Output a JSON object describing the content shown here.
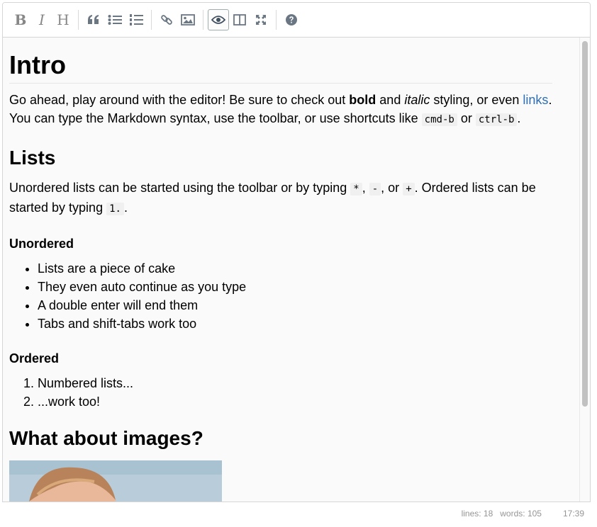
{
  "toolbar": {
    "buttons": [
      {
        "name": "bold-button",
        "glyph": "B"
      },
      {
        "name": "italic-button",
        "glyph": "I"
      },
      {
        "name": "heading-button",
        "glyph": "H"
      }
    ]
  },
  "content": {
    "intro_heading": "Intro",
    "intro_p1_a": "Go ahead, play around with the editor! Be sure to check out ",
    "intro_bold": "bold",
    "intro_p1_b": " and ",
    "intro_italic": "italic",
    "intro_p1_c": " styling, or even ",
    "intro_link": "links",
    "intro_p1_d": ". You can type the Markdown syntax, use the toolbar, or use shortcuts like ",
    "intro_code1": "cmd-b",
    "intro_p1_e": " or ",
    "intro_code2": "ctrl-b",
    "intro_p1_f": ".",
    "lists_heading": "Lists",
    "lists_p_a": "Unordered lists can be started using the toolbar or by typing ",
    "lists_code_star": "*",
    "lists_p_b": ", ",
    "lists_code_dash": "-",
    "lists_p_c": ", or ",
    "lists_code_plus": "+",
    "lists_p_d": ". Ordered lists can be started by typing ",
    "lists_code_one": "1.",
    "lists_p_e": ".",
    "unordered_heading": "Unordered",
    "unordered_items": [
      "Lists are a piece of cake",
      "They even auto continue as you type",
      "A double enter will end them",
      "Tabs and shift-tabs work too"
    ],
    "ordered_heading": "Ordered",
    "ordered_items": [
      "Numbered lists...",
      "...work too!"
    ],
    "images_heading": "What about images?"
  },
  "status": {
    "lines": "lines: 18",
    "words": "words: 105",
    "time": "17:39"
  }
}
